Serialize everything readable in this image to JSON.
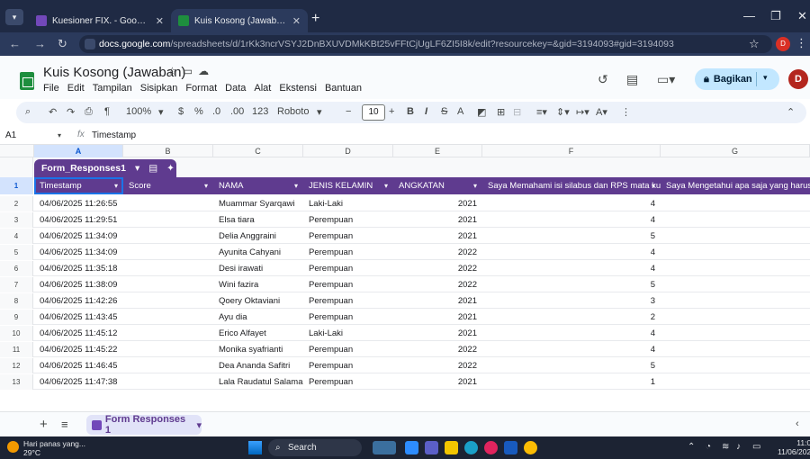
{
  "browser": {
    "tabs": [
      {
        "title": "Kuesioner FIX. - Google Formul",
        "active": false
      },
      {
        "title": "Kuis Kosong (Jawaban) - Googl",
        "active": true
      }
    ],
    "new_tab": "+",
    "url_host": "docs.google.com",
    "url_path": "/spreadsheets/d/1rKk3ncrVSYJ2DnBXUVDMkKBt25vFFtCjUgLF6ZI5I8k/edit?resourcekey=&gid=3194093#gid=3194093",
    "profile_initial": "D"
  },
  "sheets": {
    "title": "Kuis Kosong (Jawaban)",
    "menu": [
      "File",
      "Edit",
      "Tampilan",
      "Sisipkan",
      "Format",
      "Data",
      "Alat",
      "Ekstensi",
      "Bantuan"
    ],
    "share_label": "Bagikan",
    "avatar_initial": "D",
    "toolbar": {
      "zoom": "100%",
      "currency": "$",
      "percent": "%",
      "dec_decrease": ".0",
      "dec_increase": ".00",
      "number_format": "123",
      "font": "Roboto",
      "font_size": "10",
      "bold": "B",
      "italic": "I",
      "strike": "S",
      "text_color": "A"
    },
    "namebox": "A1",
    "fx": "fx",
    "formula": "Timestamp",
    "col_letters": [
      "A",
      "B",
      "C",
      "D",
      "E",
      "F",
      "G"
    ],
    "table_name": "Form_Responses1",
    "headers": [
      "Timestamp",
      "Score",
      "NAMA",
      "JENIS KELAMIN",
      "ANGKATAN",
      "Saya Memahami isi silabus dan RPS mata ku",
      "Saya Mengetahui apa saja yang harus dip"
    ],
    "header_row_num": "1",
    "rows": [
      {
        "n": "2",
        "timestamp": "04/06/2025 11:26:55",
        "nama": "Muammar Syarqawi",
        "jk": "Laki-Laki",
        "angkatan": "2021",
        "f": "4"
      },
      {
        "n": "3",
        "timestamp": "04/06/2025 11:29:51",
        "nama": "Elsa tiara",
        "jk": "Perempuan",
        "angkatan": "2021",
        "f": "4"
      },
      {
        "n": "4",
        "timestamp": "04/06/2025 11:34:09",
        "nama": "Delia Anggraini",
        "jk": "Perempuan",
        "angkatan": "2021",
        "f": "5"
      },
      {
        "n": "5",
        "timestamp": "04/06/2025 11:34:09",
        "nama": "Ayunita Cahyani",
        "jk": "Perempuan",
        "angkatan": "2022",
        "f": "4"
      },
      {
        "n": "6",
        "timestamp": "04/06/2025 11:35:18",
        "nama": "Desi irawati",
        "jk": "Perempuan",
        "angkatan": "2022",
        "f": "4"
      },
      {
        "n": "7",
        "timestamp": "04/06/2025 11:38:09",
        "nama": "Wini fazira",
        "jk": "Perempuan",
        "angkatan": "2022",
        "f": "5"
      },
      {
        "n": "8",
        "timestamp": "04/06/2025 11:42:26",
        "nama": "Qoery Oktaviani",
        "jk": "Perempuan",
        "angkatan": "2021",
        "f": "3"
      },
      {
        "n": "9",
        "timestamp": "04/06/2025 11:43:45",
        "nama": "Ayu dia",
        "jk": "Perempuan",
        "angkatan": "2021",
        "f": "2"
      },
      {
        "n": "10",
        "timestamp": "04/06/2025 11:45:12",
        "nama": "Erico Alfayet",
        "jk": "Laki-Laki",
        "angkatan": "2021",
        "f": "4"
      },
      {
        "n": "11",
        "timestamp": "04/06/2025 11:45:22",
        "nama": "Monika syafrianti",
        "jk": "Perempuan",
        "angkatan": "2022",
        "f": "4"
      },
      {
        "n": "12",
        "timestamp": "04/06/2025 11:46:45",
        "nama": "Dea Ananda Safitri",
        "jk": "Perempuan",
        "angkatan": "2022",
        "f": "5"
      },
      {
        "n": "13",
        "timestamp": "04/06/2025 11:47:38",
        "nama": "Lala Raudatul Salamah",
        "jk": "Perempuan",
        "angkatan": "2021",
        "f": "1"
      }
    ],
    "sheet_tab": "Form Responses 1"
  },
  "taskbar": {
    "weather_text": "Hari panas yang...",
    "weather_temp": "29°C",
    "search_label": "Search",
    "time": "11:03",
    "date": "11/06/2025"
  },
  "colors": {
    "table_header": "#5f3b8f",
    "share_button": "#c2e7ff",
    "tab_strip": "#1f2a44"
  }
}
